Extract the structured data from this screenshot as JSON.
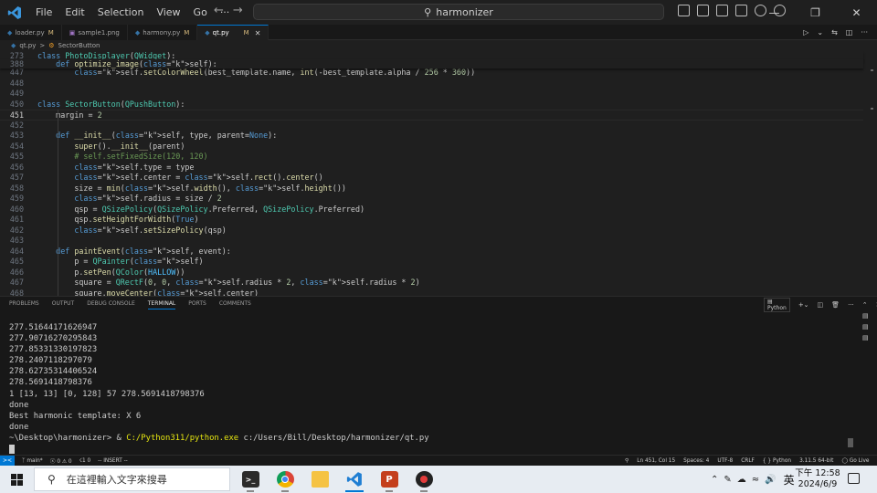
{
  "titlebar": {
    "menu": [
      "File",
      "Edit",
      "Selection",
      "View",
      "Go",
      "···"
    ],
    "search": "harmonizer",
    "window_controls": [
      "—",
      "❐",
      "✕"
    ]
  },
  "tabs": [
    {
      "name": "loader.py",
      "status": "M",
      "color": "#3572A5"
    },
    {
      "name": "sample1.png",
      "status": "",
      "color": "#a074c4"
    },
    {
      "name": "harmony.py",
      "status": "M",
      "color": "#3572A5"
    },
    {
      "name": "qt.py",
      "status": "M",
      "color": "#3572A5"
    }
  ],
  "breadcrumb": {
    "file": "qt.py",
    "sep": ">",
    "symbol": "SectorButton"
  },
  "editor": {
    "sticky_lines": [
      {
        "n": "273",
        "text": "class PhotoDisplayer(QWidget):"
      },
      {
        "n": "388",
        "text": "    def optimize_image(self):"
      }
    ],
    "lines": [
      {
        "n": "447",
        "text": "        self.setColorWheel(best_template.name, int(-best_template.alpha / 256 * 360))"
      },
      {
        "n": "448",
        "text": ""
      },
      {
        "n": "449",
        "text": ""
      },
      {
        "n": "450",
        "text": "class SectorButton(QPushButton):"
      },
      {
        "n": "451",
        "text": "    margin = 2",
        "current": true
      },
      {
        "n": "452",
        "text": ""
      },
      {
        "n": "453",
        "text": "    def __init__(self, type, parent=None):"
      },
      {
        "n": "454",
        "text": "        super().__init__(parent)"
      },
      {
        "n": "455",
        "text": "        # self.setFixedSize(120, 120)"
      },
      {
        "n": "456",
        "text": "        self.type = type"
      },
      {
        "n": "457",
        "text": "        self.center = self.rect().center()"
      },
      {
        "n": "458",
        "text": "        size = min(self.width(), self.height())"
      },
      {
        "n": "459",
        "text": "        self.radius = size / 2"
      },
      {
        "n": "460",
        "text": "        qsp = QSizePolicy(QSizePolicy.Preferred, QSizePolicy.Preferred)"
      },
      {
        "n": "461",
        "text": "        qsp.setHeightForWidth(True)"
      },
      {
        "n": "462",
        "text": "        self.setSizePolicy(qsp)"
      },
      {
        "n": "463",
        "text": ""
      },
      {
        "n": "464",
        "text": "    def paintEvent(self, event):"
      },
      {
        "n": "465",
        "text": "        p = QPainter(self)"
      },
      {
        "n": "466",
        "text": "        p.setPen(QColor(HALLOW))"
      },
      {
        "n": "467",
        "text": "        square = QRectF(0, 0, self.radius * 2, self.radius * 2)"
      },
      {
        "n": "468",
        "text": "        square.moveCenter(self.center)"
      }
    ]
  },
  "panel": {
    "tabs": [
      "PROBLEMS",
      "OUTPUT",
      "DEBUG CONSOLE",
      "TERMINAL",
      "PORTS",
      "COMMENTS"
    ],
    "active_tab": "TERMINAL",
    "shell": "Python",
    "terminal_lines": [
      "277.51644171626947",
      "277.90716270295843",
      "277.85331330197823",
      "278.2407118297079",
      "278.62735314406524",
      "278.5691418798376",
      "1 [13, 13] [0, 128] 57 278.5691418798376",
      "done",
      "Best harmonic template: X 6",
      "done"
    ],
    "prompt": {
      "path": "~\\Desktop\\harmonizer> & ",
      "exe": "C:/Python311/python.exe",
      "arg": " c:/Users/Bill/Desktop/harmonizer/qt.py"
    }
  },
  "statusbar": {
    "branch": "main*",
    "errors": "ⓧ 0 ⚠ 0",
    "ports": "☇1 0",
    "mode": "-- INSERT --",
    "position": "Ln 451, Col 15",
    "spaces": "Spaces: 4",
    "encoding": "UTF-8",
    "eol": "CRLF",
    "language": "Python",
    "interpreter": "3.11.5 64-bit",
    "golive": "Go Live"
  },
  "taskbar": {
    "search_placeholder": "在這裡輸入文字來搜尋",
    "ime": "英",
    "time": "下午 12:58",
    "date": "2024/6/9"
  }
}
